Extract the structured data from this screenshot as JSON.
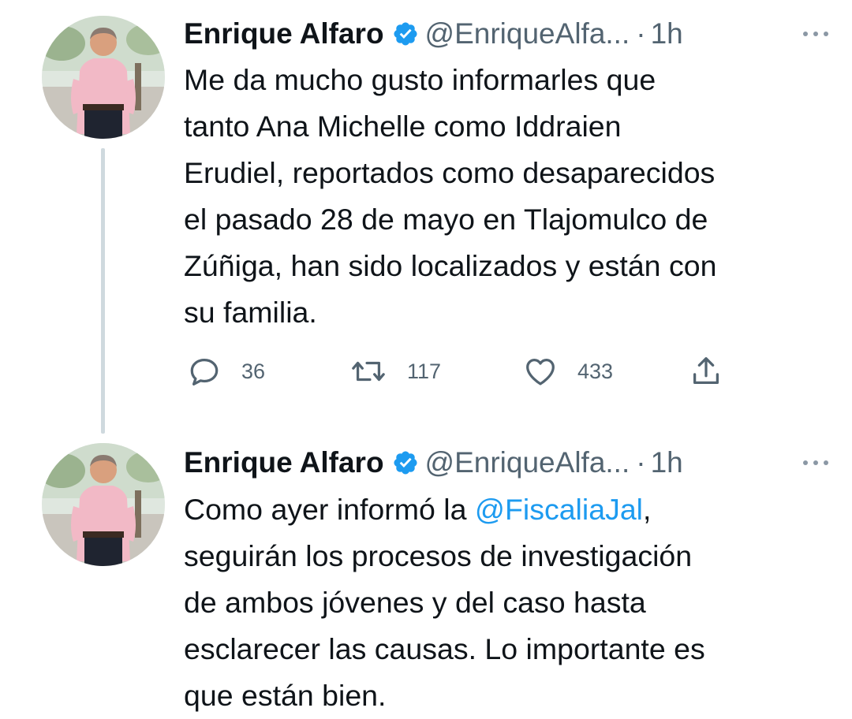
{
  "tweets": [
    {
      "author": {
        "name": "Enrique Alfaro",
        "handle": "@EnriqueAlfa...",
        "verified": true,
        "avatar_icon": "profile-photo"
      },
      "time": "1h",
      "separator": "·",
      "more_icon": "more-horizontal-icon",
      "text": "Me da mucho gusto informarles que\ntanto Ana Michelle como Iddraien\nErudiel, reportados como desaparecidos\nel pasado 28 de mayo en Tlajomulco de\nZúñiga, han sido localizados y están con\nsu familia.",
      "actions": {
        "replies": "36",
        "retweets": "117",
        "likes": "433",
        "reply_icon": "reply-icon",
        "retweet_icon": "retweet-icon",
        "like_icon": "heart-icon",
        "share_icon": "share-icon"
      }
    },
    {
      "author": {
        "name": "Enrique Alfaro",
        "handle": "@EnriqueAlfa...",
        "verified": true,
        "avatar_icon": "profile-photo"
      },
      "time": "1h",
      "separator": "·",
      "more_icon": "more-horizontal-icon",
      "text_before": "Como ayer informó la ",
      "mention": "@FiscaliaJal",
      "text_after": ",\nseguirán los procesos de investigación\nde ambos jóvenes y del caso hasta\nesclarecer las causas. Lo importante es\nque están bien."
    }
  ],
  "colors": {
    "text": "#0f1419",
    "secondary": "#536471",
    "link": "#1d9bf0",
    "verified": "#1d9bf0",
    "thread_line": "#cfd9de"
  }
}
